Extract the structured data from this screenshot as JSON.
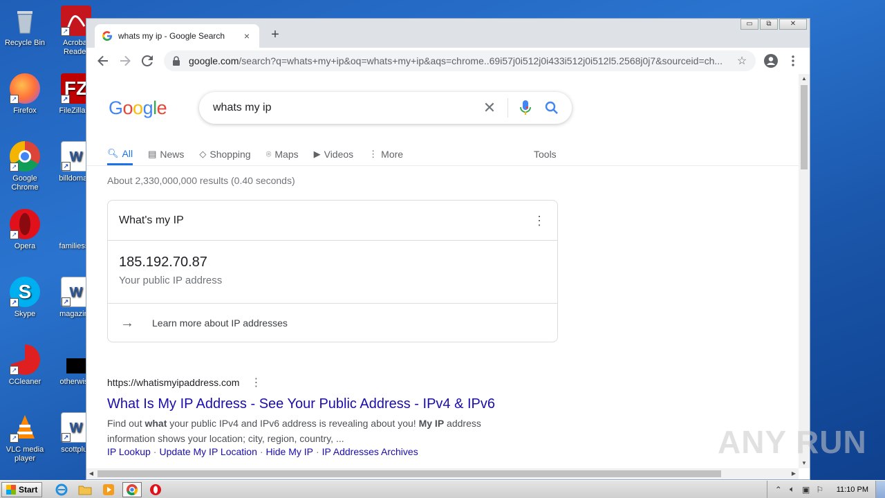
{
  "desktop": {
    "icons": [
      {
        "label": "Recycle Bin",
        "icon": "recycle-bin-icon"
      },
      {
        "label": "Acrobat Reader",
        "icon": "acrobat-reader-icon"
      },
      {
        "label": "Firefox",
        "icon": "firefox-icon"
      },
      {
        "label": "FileZilla C",
        "icon": "filezilla-icon"
      },
      {
        "label": "Google Chrome",
        "icon": "chrome-icon"
      },
      {
        "label": "billdomain",
        "icon": "word-document-icon"
      },
      {
        "label": "Opera",
        "icon": "opera-icon"
      },
      {
        "label": "familiessb",
        "icon": "document-icon"
      },
      {
        "label": "Skype",
        "icon": "skype-icon"
      },
      {
        "label": "magazine",
        "icon": "word-document-icon"
      },
      {
        "label": "CCleaner",
        "icon": "ccleaner-icon"
      },
      {
        "label": "otherwise",
        "icon": "black-file-icon"
      },
      {
        "label": "VLC media player",
        "icon": "vlc-icon"
      },
      {
        "label": "scottplus",
        "icon": "word-document-icon"
      }
    ]
  },
  "browser": {
    "tab_title": "whats my ip - Google Search",
    "tab_close": "×",
    "new_tab": "+",
    "window_controls": {
      "minimize": "▭",
      "restore": "⧉",
      "close": "✕"
    },
    "url_host": "google.com",
    "url_path": "/search?q=whats+my+ip&oq=whats+my+ip&aqs=chrome..69i57j0i512j0i433i512j0i512l5.2568j0j7&sourceid=ch..."
  },
  "google": {
    "logo": "Google",
    "query": "whats my ip",
    "tabs": [
      {
        "label": "All",
        "icon": "search-icon"
      },
      {
        "label": "News",
        "icon": "news-icon"
      },
      {
        "label": "Shopping",
        "icon": "tag-icon"
      },
      {
        "label": "Maps",
        "icon": "map-pin-icon"
      },
      {
        "label": "Videos",
        "icon": "play-icon"
      },
      {
        "label": "More",
        "icon": "more-vertical-icon"
      }
    ],
    "tools": "Tools",
    "stats": "About 2,330,000,000 results (0.40 seconds)",
    "ip_card": {
      "title": "What's my IP",
      "ip": "185.192.70.87",
      "subtitle": "Your public IP address",
      "learn_more": "Learn more about IP addresses"
    },
    "result": {
      "cite": "https://whatismyipaddress.com",
      "title": "What Is My IP Address - See Your Public Address - IPv4 & IPv6",
      "snippet_1": "Find out ",
      "snippet_b1": "what",
      "snippet_2": " your public IPv4 and IPv6 address is revealing about you! ",
      "snippet_b2": "My IP",
      "snippet_3": " address information shows your location; city, region, country, ...",
      "sitelinks": [
        "IP Lookup",
        "Update My IP Location",
        "Hide My IP",
        "IP Addresses Archives"
      ]
    }
  },
  "watermark": "ANY RUN",
  "taskbar": {
    "start": "Start",
    "clock": "11:10 PM",
    "pinned": [
      "internet-explorer-icon",
      "folder-icon",
      "media-player-icon",
      "chrome-icon",
      "opera-icon"
    ]
  }
}
